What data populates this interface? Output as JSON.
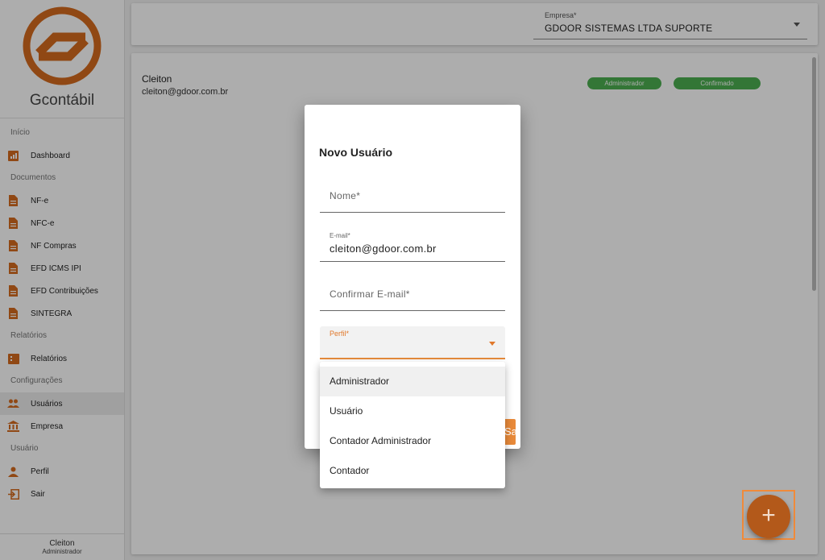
{
  "app": {
    "brand": "Gcontábil"
  },
  "sidebar": {
    "sections": [
      {
        "title": "Início",
        "items": [
          {
            "label": "Dashboard",
            "icon": "chart-icon"
          }
        ]
      },
      {
        "title": "Documentos",
        "items": [
          {
            "label": "NF-e",
            "icon": "document-icon"
          },
          {
            "label": "NFC-e",
            "icon": "document-icon"
          },
          {
            "label": "NF Compras",
            "icon": "document-icon"
          },
          {
            "label": "EFD ICMS IPI",
            "icon": "document-icon"
          },
          {
            "label": "EFD Contribuições",
            "icon": "document-icon"
          },
          {
            "label": "SINTEGRA",
            "icon": "document-icon"
          }
        ]
      },
      {
        "title": "Relatórios",
        "items": [
          {
            "label": "Relatórios",
            "icon": "report-icon"
          }
        ]
      },
      {
        "title": "Configurações",
        "items": [
          {
            "label": "Usuários",
            "icon": "users-icon",
            "active": true
          },
          {
            "label": "Empresa",
            "icon": "bank-icon"
          }
        ]
      },
      {
        "title": "Usuário",
        "items": [
          {
            "label": "Perfil",
            "icon": "person-icon"
          },
          {
            "label": "Sair",
            "icon": "exit-icon"
          }
        ]
      }
    ],
    "footer": {
      "name": "Cleiton",
      "role": "Administrador"
    }
  },
  "topbar": {
    "empresa_label": "Empresa*",
    "empresa_value": "GDOOR SISTEMAS LTDA SUPORTE"
  },
  "user_list": [
    {
      "name": "Cleiton",
      "email": "cleiton@gdoor.com.br",
      "role_badge": "Administrador",
      "status_badge": "Confirmado"
    }
  ],
  "dialog": {
    "title": "Novo Usuário",
    "nome_placeholder": "Nome*",
    "email_label": "E-mail*",
    "email_value": "cleiton@gdoor.com.br",
    "confirm_placeholder": "Confirmar E-mail*",
    "perfil_label": "Perfil*",
    "save_label": "Salvar"
  },
  "perfil_options": [
    {
      "label": "Administrador",
      "highlighted": true
    },
    {
      "label": "Usuário"
    },
    {
      "label": "Contador Administrador"
    },
    {
      "label": "Contador"
    }
  ],
  "fab": {
    "label": "+"
  },
  "colors": {
    "accent": "#e0782a",
    "badge_green": "#4caf50",
    "fab": "#b3591a"
  }
}
